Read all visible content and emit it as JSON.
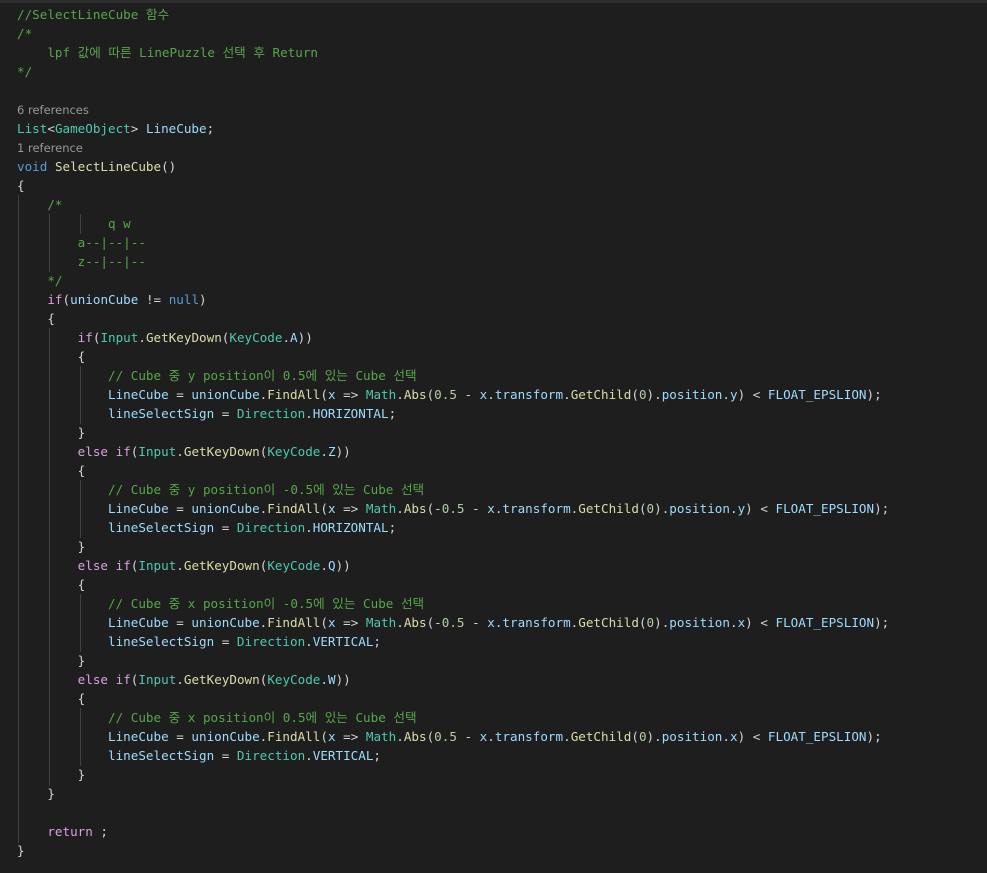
{
  "colors": {
    "background": "#1e1e1e",
    "comment": "#57a64a",
    "keyword": "#569cd6",
    "control": "#d8a0df",
    "type": "#4ec9b0",
    "identifier": "#9cdcfe",
    "method": "#dcdcaa",
    "number": "#b5cea8",
    "plain": "#d4d4d4",
    "codelens": "#999999"
  },
  "codelens": {
    "line_cube_refs": "6 references",
    "select_line_cube_refs": "1 reference"
  },
  "lines": [
    {
      "tokens": [
        [
          "comment",
          "//SelectLineCube 함수"
        ]
      ]
    },
    {
      "tokens": [
        [
          "comment",
          "/*"
        ]
      ]
    },
    {
      "tokens": [
        [
          "comment",
          "    lpf 값에 따른 LinePuzzle 선택 후 Return"
        ]
      ]
    },
    {
      "tokens": [
        [
          "comment",
          "*/"
        ]
      ]
    },
    {
      "tokens": []
    },
    {
      "tokens": [
        [
          "type",
          "List"
        ],
        [
          "plain",
          "<"
        ],
        [
          "type",
          "GameObject"
        ],
        [
          "plain",
          "> "
        ],
        [
          "ident",
          "LineCube"
        ],
        [
          "plain",
          ";"
        ]
      ]
    },
    {
      "tokens": [
        [
          "keyword",
          "void"
        ],
        [
          "plain",
          " "
        ],
        [
          "method",
          "SelectLineCube"
        ],
        [
          "plain",
          "()"
        ]
      ]
    },
    {
      "tokens": [
        [
          "plain",
          "{"
        ]
      ]
    },
    {
      "tokens": [
        [
          "comment",
          "    /*"
        ]
      ]
    },
    {
      "tokens": [
        [
          "comment",
          "            q w"
        ]
      ]
    },
    {
      "tokens": [
        [
          "comment",
          "        a--|--|--"
        ]
      ]
    },
    {
      "tokens": [
        [
          "comment",
          "        z--|--|--"
        ]
      ]
    },
    {
      "tokens": [
        [
          "comment",
          "    */"
        ]
      ]
    },
    {
      "tokens": [
        [
          "plain",
          "    "
        ],
        [
          "control",
          "if"
        ],
        [
          "plain",
          "("
        ],
        [
          "ident",
          "unionCube"
        ],
        [
          "plain",
          " != "
        ],
        [
          "keyword",
          "null"
        ],
        [
          "plain",
          ")"
        ]
      ]
    },
    {
      "tokens": [
        [
          "plain",
          "    {"
        ]
      ]
    },
    {
      "tokens": [
        [
          "plain",
          "        "
        ],
        [
          "control",
          "if"
        ],
        [
          "plain",
          "("
        ],
        [
          "type",
          "Input"
        ],
        [
          "plain",
          "."
        ],
        [
          "method",
          "GetKeyDown"
        ],
        [
          "plain",
          "("
        ],
        [
          "type",
          "KeyCode"
        ],
        [
          "plain",
          "."
        ],
        [
          "ident",
          "A"
        ],
        [
          "plain",
          "))"
        ]
      ]
    },
    {
      "tokens": [
        [
          "plain",
          "        {"
        ]
      ]
    },
    {
      "tokens": [
        [
          "comment",
          "            // Cube 중 y position이 0.5에 있는 Cube 선택"
        ]
      ]
    },
    {
      "tokens": [
        [
          "plain",
          "            "
        ],
        [
          "ident",
          "LineCube"
        ],
        [
          "plain",
          " = "
        ],
        [
          "ident",
          "unionCube"
        ],
        [
          "plain",
          "."
        ],
        [
          "method",
          "FindAll"
        ],
        [
          "plain",
          "("
        ],
        [
          "ident",
          "x"
        ],
        [
          "plain",
          " => "
        ],
        [
          "type",
          "Math"
        ],
        [
          "plain",
          "."
        ],
        [
          "method",
          "Abs"
        ],
        [
          "plain",
          "("
        ],
        [
          "number",
          "0.5"
        ],
        [
          "plain",
          " - "
        ],
        [
          "ident",
          "x"
        ],
        [
          "plain",
          "."
        ],
        [
          "ident",
          "transform"
        ],
        [
          "plain",
          "."
        ],
        [
          "method",
          "GetChild"
        ],
        [
          "plain",
          "("
        ],
        [
          "number",
          "0"
        ],
        [
          "plain",
          ")."
        ],
        [
          "ident",
          "position"
        ],
        [
          "plain",
          "."
        ],
        [
          "ident",
          "y"
        ],
        [
          "plain",
          ") < "
        ],
        [
          "const",
          "FLOAT_EPSLION"
        ],
        [
          "plain",
          ");"
        ]
      ]
    },
    {
      "tokens": [
        [
          "plain",
          "            "
        ],
        [
          "ident",
          "lineSelectSign"
        ],
        [
          "plain",
          " = "
        ],
        [
          "type",
          "Direction"
        ],
        [
          "plain",
          "."
        ],
        [
          "const",
          "HORIZONTAL"
        ],
        [
          "plain",
          ";"
        ]
      ]
    },
    {
      "tokens": [
        [
          "plain",
          "        }"
        ]
      ]
    },
    {
      "tokens": [
        [
          "plain",
          "        "
        ],
        [
          "control",
          "else"
        ],
        [
          "plain",
          " "
        ],
        [
          "control",
          "if"
        ],
        [
          "plain",
          "("
        ],
        [
          "type",
          "Input"
        ],
        [
          "plain",
          "."
        ],
        [
          "method",
          "GetKeyDown"
        ],
        [
          "plain",
          "("
        ],
        [
          "type",
          "KeyCode"
        ],
        [
          "plain",
          "."
        ],
        [
          "ident",
          "Z"
        ],
        [
          "plain",
          "))"
        ]
      ]
    },
    {
      "tokens": [
        [
          "plain",
          "        {"
        ]
      ]
    },
    {
      "tokens": [
        [
          "comment",
          "            // Cube 중 y position이 -0.5에 있는 Cube 선택"
        ]
      ]
    },
    {
      "tokens": [
        [
          "plain",
          "            "
        ],
        [
          "ident",
          "LineCube"
        ],
        [
          "plain",
          " = "
        ],
        [
          "ident",
          "unionCube"
        ],
        [
          "plain",
          "."
        ],
        [
          "method",
          "FindAll"
        ],
        [
          "plain",
          "("
        ],
        [
          "ident",
          "x"
        ],
        [
          "plain",
          " => "
        ],
        [
          "type",
          "Math"
        ],
        [
          "plain",
          "."
        ],
        [
          "method",
          "Abs"
        ],
        [
          "plain",
          "(-"
        ],
        [
          "number",
          "0.5"
        ],
        [
          "plain",
          " - "
        ],
        [
          "ident",
          "x"
        ],
        [
          "plain",
          "."
        ],
        [
          "ident",
          "transform"
        ],
        [
          "plain",
          "."
        ],
        [
          "method",
          "GetChild"
        ],
        [
          "plain",
          "("
        ],
        [
          "number",
          "0"
        ],
        [
          "plain",
          ")."
        ],
        [
          "ident",
          "position"
        ],
        [
          "plain",
          "."
        ],
        [
          "ident",
          "y"
        ],
        [
          "plain",
          ") < "
        ],
        [
          "const",
          "FLOAT_EPSLION"
        ],
        [
          "plain",
          ");"
        ]
      ]
    },
    {
      "tokens": [
        [
          "plain",
          "            "
        ],
        [
          "ident",
          "lineSelectSign"
        ],
        [
          "plain",
          " = "
        ],
        [
          "type",
          "Direction"
        ],
        [
          "plain",
          "."
        ],
        [
          "const",
          "HORIZONTAL"
        ],
        [
          "plain",
          ";"
        ]
      ]
    },
    {
      "tokens": [
        [
          "plain",
          "        }"
        ]
      ]
    },
    {
      "tokens": [
        [
          "plain",
          "        "
        ],
        [
          "control",
          "else"
        ],
        [
          "plain",
          " "
        ],
        [
          "control",
          "if"
        ],
        [
          "plain",
          "("
        ],
        [
          "type",
          "Input"
        ],
        [
          "plain",
          "."
        ],
        [
          "method",
          "GetKeyDown"
        ],
        [
          "plain",
          "("
        ],
        [
          "type",
          "KeyCode"
        ],
        [
          "plain",
          "."
        ],
        [
          "ident",
          "Q"
        ],
        [
          "plain",
          "))"
        ]
      ]
    },
    {
      "tokens": [
        [
          "plain",
          "        {"
        ]
      ]
    },
    {
      "tokens": [
        [
          "comment",
          "            // Cube 중 x position이 -0.5에 있는 Cube 선택"
        ]
      ]
    },
    {
      "tokens": [
        [
          "plain",
          "            "
        ],
        [
          "ident",
          "LineCube"
        ],
        [
          "plain",
          " = "
        ],
        [
          "ident",
          "unionCube"
        ],
        [
          "plain",
          "."
        ],
        [
          "method",
          "FindAll"
        ],
        [
          "plain",
          "("
        ],
        [
          "ident",
          "x"
        ],
        [
          "plain",
          " => "
        ],
        [
          "type",
          "Math"
        ],
        [
          "plain",
          "."
        ],
        [
          "method",
          "Abs"
        ],
        [
          "plain",
          "(-"
        ],
        [
          "number",
          "0.5"
        ],
        [
          "plain",
          " - "
        ],
        [
          "ident",
          "x"
        ],
        [
          "plain",
          "."
        ],
        [
          "ident",
          "transform"
        ],
        [
          "plain",
          "."
        ],
        [
          "method",
          "GetChild"
        ],
        [
          "plain",
          "("
        ],
        [
          "number",
          "0"
        ],
        [
          "plain",
          ")."
        ],
        [
          "ident",
          "position"
        ],
        [
          "plain",
          "."
        ],
        [
          "ident",
          "x"
        ],
        [
          "plain",
          ") < "
        ],
        [
          "const",
          "FLOAT_EPSLION"
        ],
        [
          "plain",
          ");"
        ]
      ]
    },
    {
      "tokens": [
        [
          "plain",
          "            "
        ],
        [
          "ident",
          "lineSelectSign"
        ],
        [
          "plain",
          " = "
        ],
        [
          "type",
          "Direction"
        ],
        [
          "plain",
          "."
        ],
        [
          "const",
          "VERTICAL"
        ],
        [
          "plain",
          ";"
        ]
      ]
    },
    {
      "tokens": [
        [
          "plain",
          "        }"
        ]
      ]
    },
    {
      "tokens": [
        [
          "plain",
          "        "
        ],
        [
          "control",
          "else"
        ],
        [
          "plain",
          " "
        ],
        [
          "control",
          "if"
        ],
        [
          "plain",
          "("
        ],
        [
          "type",
          "Input"
        ],
        [
          "plain",
          "."
        ],
        [
          "method",
          "GetKeyDown"
        ],
        [
          "plain",
          "("
        ],
        [
          "type",
          "KeyCode"
        ],
        [
          "plain",
          "."
        ],
        [
          "ident",
          "W"
        ],
        [
          "plain",
          "))"
        ]
      ]
    },
    {
      "tokens": [
        [
          "plain",
          "        {"
        ]
      ]
    },
    {
      "tokens": [
        [
          "comment",
          "            // Cube 중 x position이 0.5에 있는 Cube 선택"
        ]
      ]
    },
    {
      "tokens": [
        [
          "plain",
          "            "
        ],
        [
          "ident",
          "LineCube"
        ],
        [
          "plain",
          " = "
        ],
        [
          "ident",
          "unionCube"
        ],
        [
          "plain",
          "."
        ],
        [
          "method",
          "FindAll"
        ],
        [
          "plain",
          "("
        ],
        [
          "ident",
          "x"
        ],
        [
          "plain",
          " => "
        ],
        [
          "type",
          "Math"
        ],
        [
          "plain",
          "."
        ],
        [
          "method",
          "Abs"
        ],
        [
          "plain",
          "("
        ],
        [
          "number",
          "0.5"
        ],
        [
          "plain",
          " - "
        ],
        [
          "ident",
          "x"
        ],
        [
          "plain",
          "."
        ],
        [
          "ident",
          "transform"
        ],
        [
          "plain",
          "."
        ],
        [
          "method",
          "GetChild"
        ],
        [
          "plain",
          "("
        ],
        [
          "number",
          "0"
        ],
        [
          "plain",
          ")."
        ],
        [
          "ident",
          "position"
        ],
        [
          "plain",
          "."
        ],
        [
          "ident",
          "x"
        ],
        [
          "plain",
          ") < "
        ],
        [
          "const",
          "FLOAT_EPSLION"
        ],
        [
          "plain",
          ");"
        ]
      ]
    },
    {
      "tokens": [
        [
          "plain",
          "            "
        ],
        [
          "ident",
          "lineSelectSign"
        ],
        [
          "plain",
          " = "
        ],
        [
          "type",
          "Direction"
        ],
        [
          "plain",
          "."
        ],
        [
          "const",
          "VERTICAL"
        ],
        [
          "plain",
          ";"
        ]
      ]
    },
    {
      "tokens": [
        [
          "plain",
          "        }"
        ]
      ]
    },
    {
      "tokens": [
        [
          "plain",
          "    }"
        ]
      ]
    },
    {
      "tokens": []
    },
    {
      "tokens": [
        [
          "plain",
          "    "
        ],
        [
          "control",
          "return"
        ],
        [
          "plain",
          " ;"
        ]
      ]
    },
    {
      "tokens": [
        [
          "plain",
          "}"
        ]
      ]
    }
  ]
}
